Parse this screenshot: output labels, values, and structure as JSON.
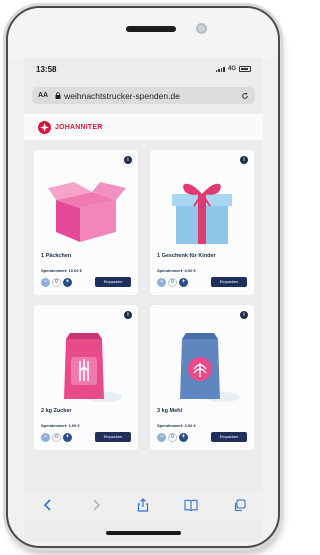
{
  "status_bar": {
    "time": "13:58",
    "network": "4G"
  },
  "address_bar": {
    "aa_label": "AA",
    "url": "weihnachtstrucker-spenden.de"
  },
  "site": {
    "brand": "JOHANNITER"
  },
  "products": [
    {
      "title": "1 Päckchen",
      "worth": "Spendenwert: 10.00 €",
      "qty": "0",
      "cta": "Einpacken",
      "illustration": "box-icon"
    },
    {
      "title": "1 Geschenk für Kinder",
      "worth": "Spendenwert: 3.00 €",
      "qty": "0",
      "cta": "Einpacken",
      "illustration": "gift-icon"
    },
    {
      "title": "2 kg Zucker",
      "worth": "Spendenwert: 2.00 €",
      "qty": "0",
      "cta": "Einpacken",
      "illustration": "sugar-bag-icon"
    },
    {
      "title": "3 kg Mehl",
      "worth": "Spendenwert: 3.00 €",
      "qty": "0",
      "cta": "Einpacken",
      "illustration": "flour-bag-icon"
    }
  ],
  "info_symbol": "i",
  "qty_minus": "−",
  "qty_plus": "+",
  "colors": {
    "brand_red": "#d6163c",
    "navy": "#1f2f5c",
    "pink": "#e94a8a",
    "sky": "#8ec6ea"
  }
}
